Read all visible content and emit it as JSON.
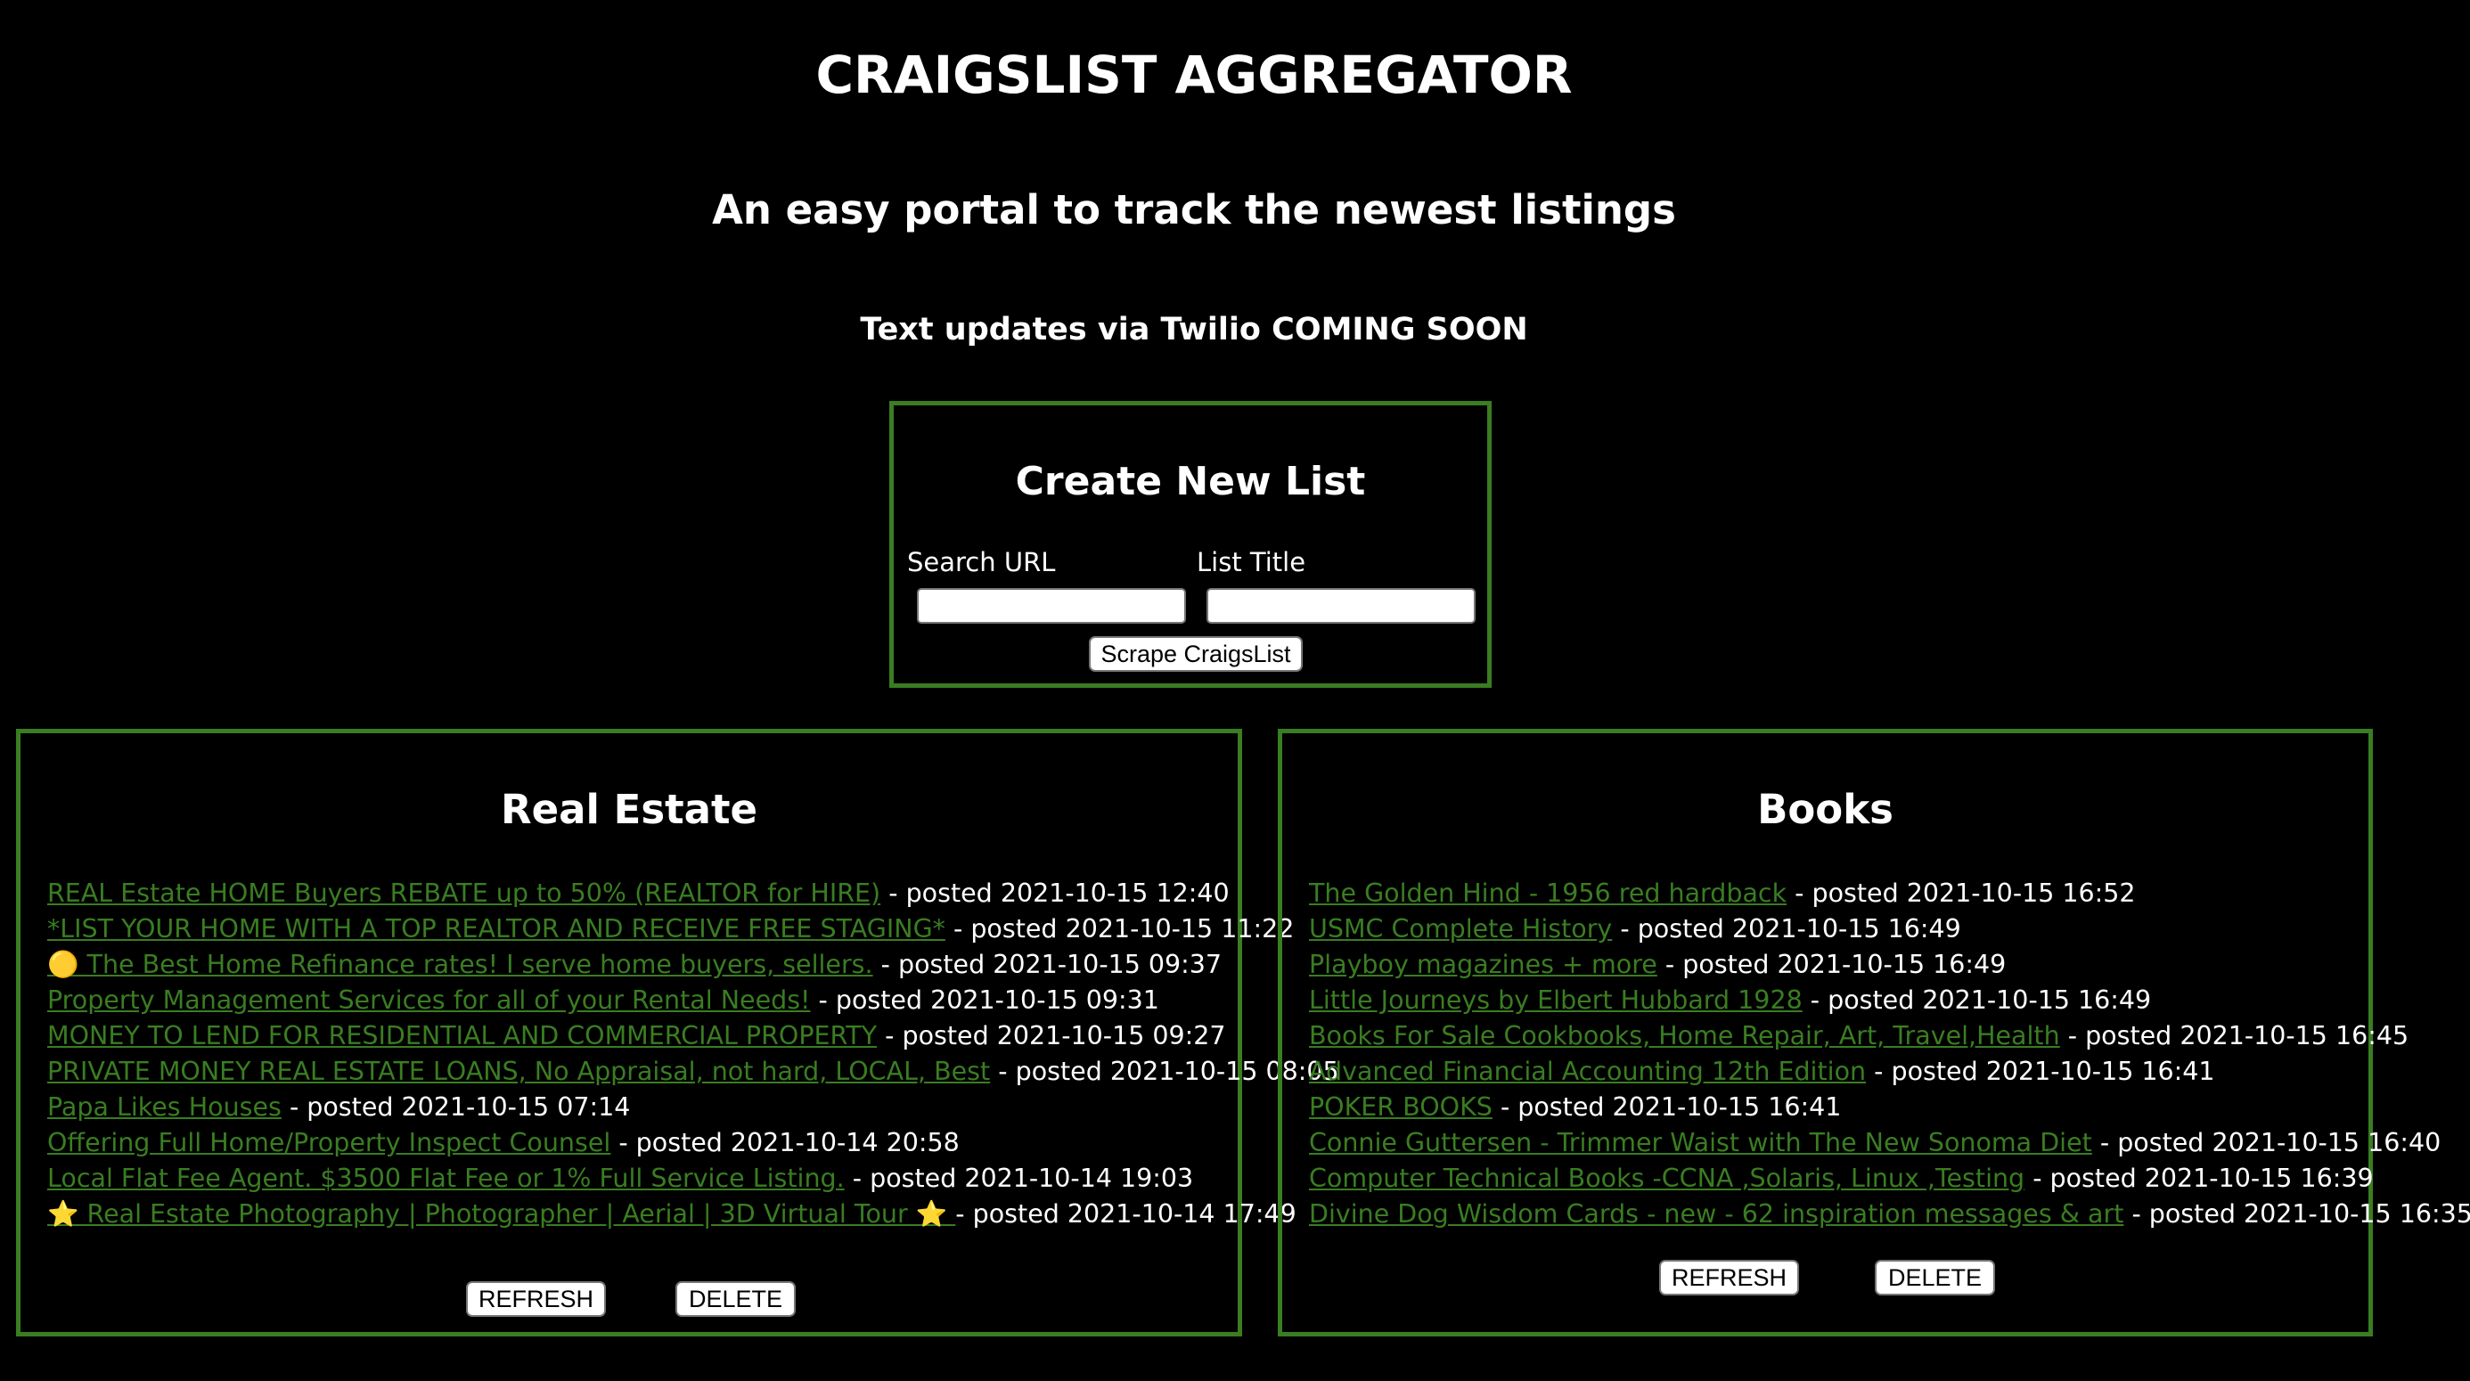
{
  "header": {
    "title": "CRAIGSLIST AGGREGATOR",
    "subtitle": "An easy portal to track the newest listings",
    "notice": "Text updates via Twilio COMING SOON"
  },
  "create_form": {
    "title": "Create New List",
    "search_url_label": "Search URL",
    "search_url_value": "",
    "list_title_label": "List Title",
    "list_title_value": "",
    "submit_label": "Scrape CraigsList"
  },
  "lists": [
    {
      "title": "Real Estate",
      "refresh_label": "REFRESH",
      "delete_label": "DELETE",
      "items": [
        {
          "link": "REAL Estate HOME Buyers REBATE up to 50% (REALTOR for HIRE)",
          "posted": "- posted 2021-10-15 12:40"
        },
        {
          "link": "*LIST YOUR HOME WITH A TOP REALTOR AND RECEIVE FREE STAGING*",
          "posted": "- posted 2021-10-15 11:22"
        },
        {
          "link": "🟡  The Best Home Refinance rates! I serve home buyers, sellers.",
          "posted": "- posted 2021-10-15 09:37"
        },
        {
          "link": "Property Management Services for all of your Rental Needs!",
          "posted": "- posted 2021-10-15 09:31"
        },
        {
          "link": "MONEY TO LEND FOR RESIDENTIAL AND COMMERCIAL PROPERTY",
          "posted": "- posted 2021-10-15 09:27"
        },
        {
          "link": "PRIVATE MONEY REAL ESTATE LOANS, No Appraisal, not hard, LOCAL, Best",
          "posted": "- posted 2021-10-15 08:05"
        },
        {
          "link": "Papa Likes Houses",
          "posted": "- posted 2021-10-15 07:14"
        },
        {
          "link": "Offering Full Home/Property Inspect Counsel",
          "posted": "- posted 2021-10-14 20:58"
        },
        {
          "link": "Local Flat Fee Agent. $3500 Flat Fee or 1% Full Service Listing.",
          "posted": "- posted 2021-10-14 19:03"
        },
        {
          "link": "⭐  Real Estate Photography | Photographer | Aerial | 3D Virtual Tour ⭐ ",
          "posted": "- posted 2021-10-14 17:49"
        }
      ]
    },
    {
      "title": "Books",
      "refresh_label": "REFRESH",
      "delete_label": "DELETE",
      "items": [
        {
          "link": "The Golden Hind - 1956 red hardback",
          "posted": "- posted 2021-10-15 16:52"
        },
        {
          "link": "USMC Complete History",
          "posted": "- posted 2021-10-15 16:49"
        },
        {
          "link": "Playboy magazines + more",
          "posted": "- posted 2021-10-15 16:49"
        },
        {
          "link": "Little Journeys by Elbert Hubbard 1928",
          "posted": "- posted 2021-10-15 16:49"
        },
        {
          "link": "Books For Sale Cookbooks, Home Repair, Art, Travel,Health",
          "posted": "- posted 2021-10-15 16:45"
        },
        {
          "link": "Advanced Financial Accounting 12th Edition",
          "posted": "- posted 2021-10-15 16:41"
        },
        {
          "link": "POKER BOOKS",
          "posted": "- posted 2021-10-15 16:41"
        },
        {
          "link": "Connie Guttersen - Trimmer Waist with The New Sonoma Diet",
          "posted": "- posted 2021-10-15 16:40"
        },
        {
          "link": "Computer Technical Books -CCNA ,Solaris, Linux ,Testing",
          "posted": "- posted 2021-10-15 16:39"
        },
        {
          "link": "Divine Dog Wisdom Cards - new - 62 inspiration messages & art",
          "posted": "- posted 2021-10-15 16:35"
        }
      ]
    }
  ],
  "colors": {
    "background": "#000000",
    "text": "#ffffff",
    "accent": "#3a7d22"
  }
}
